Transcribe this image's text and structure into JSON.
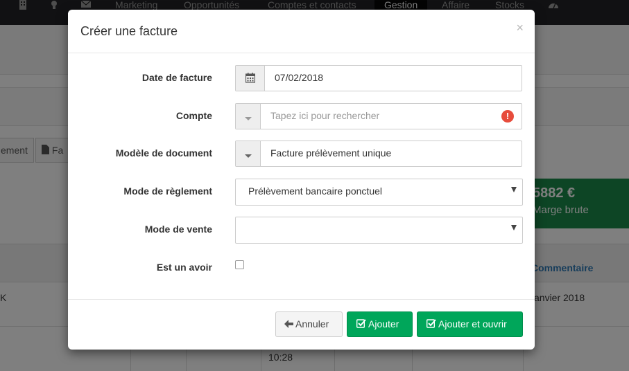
{
  "topnav": {
    "items": [
      {
        "label": "Marketing"
      },
      {
        "label": "Opportunités"
      },
      {
        "label": "Comptes et contacts"
      },
      {
        "label": "Gestion"
      },
      {
        "label": "Affaire"
      },
      {
        "label": "Stocks"
      }
    ],
    "active": "Gestion"
  },
  "background": {
    "tab_left_label": "ement",
    "tab_right_label": "Fa",
    "kpi": {
      "value": "5882 €",
      "label": "Marge brute",
      "color": "#1b8b4a"
    },
    "column_header": "Commentaire",
    "row1": {
      "left": "K",
      "right": "anvier 2018"
    },
    "row2": {
      "time": "10:28"
    }
  },
  "modal": {
    "title": "Créer une facture",
    "close_label": "×",
    "fields": {
      "date": {
        "label": "Date de facture",
        "value": "07/02/2018",
        "icon": "calendar-icon"
      },
      "compte": {
        "label": "Compte",
        "placeholder": "Tapez ici pour rechercher",
        "warning_icon": "!"
      },
      "modele": {
        "label": "Modèle de document",
        "value": "Facture prélèvement unique"
      },
      "reglement": {
        "label": "Mode de règlement",
        "value": "Prélèvement bancaire ponctuel"
      },
      "vente": {
        "label": "Mode de vente",
        "value": ""
      },
      "avoir": {
        "label": "Est un avoir",
        "checked": false
      }
    },
    "footer": {
      "cancel_label": "Annuler",
      "add_label": "Ajouter",
      "add_open_label": "Ajouter et ouvrir"
    }
  },
  "colors": {
    "success": "#00a65a",
    "danger": "#e74c3c",
    "accent_link": "#2f7bb6"
  }
}
